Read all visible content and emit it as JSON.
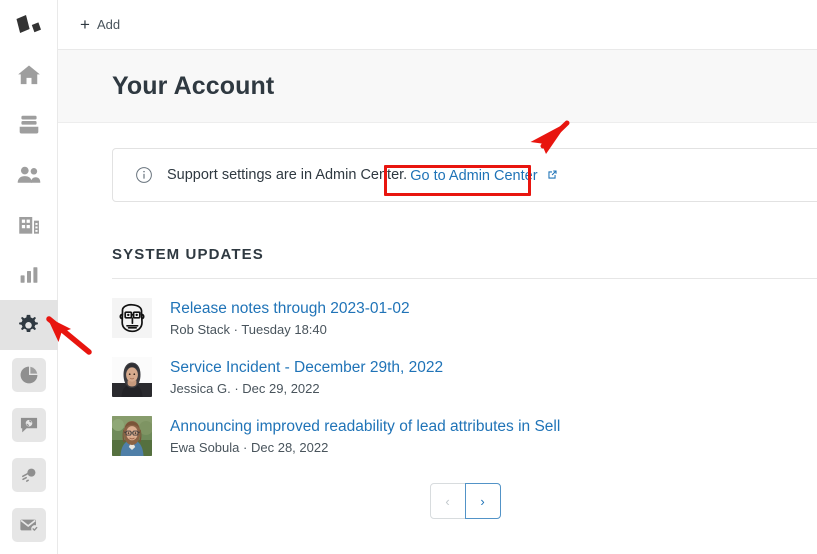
{
  "sidebar": {
    "logo": {
      "name": "zendesk-logo"
    },
    "nav_items": [
      {
        "icon": "home-icon",
        "label": "Home",
        "active": false
      },
      {
        "icon": "views-icon",
        "label": "Views",
        "active": false
      },
      {
        "icon": "customers-icon",
        "label": "Customers",
        "active": false
      },
      {
        "icon": "organizations-icon",
        "label": "Organizations",
        "active": false
      },
      {
        "icon": "reporting-icon",
        "label": "Reporting",
        "active": false
      },
      {
        "icon": "gear-icon",
        "label": "Admin",
        "active": true
      }
    ],
    "app_items": [
      {
        "icon": "explore-icon",
        "label": "Explore"
      },
      {
        "icon": "chat-icon",
        "label": "Chat"
      },
      {
        "icon": "guide-icon",
        "label": "Guide"
      },
      {
        "icon": "mail-check-icon",
        "label": "Email"
      }
    ]
  },
  "topbar": {
    "add_label": "Add",
    "add_icon": "plus-icon"
  },
  "header": {
    "title": "Your Account"
  },
  "notice": {
    "icon": "info-circle-icon",
    "text": "Support settings are in Admin Center.",
    "link_label": "Go to Admin Center",
    "link_icon": "external-link-icon"
  },
  "system_updates": {
    "section_label": "SYSTEM UPDATES",
    "items": [
      {
        "title": "Release notes through 2023-01-02",
        "author": "Rob Stack",
        "separator": "·",
        "date": "Tuesday 18:40",
        "avatar": "avatar-doodle-face"
      },
      {
        "title": "Service Incident - December 29th, 2022",
        "author": "Jessica G.",
        "separator": "·",
        "date": "Dec 29, 2022",
        "avatar": "avatar-dark-hair-woman"
      },
      {
        "title": "Announcing improved readability of lead attributes in Sell",
        "author": "Ewa Sobula",
        "separator": "·",
        "date": "Dec 28, 2022",
        "avatar": "avatar-glasses-woman"
      }
    ],
    "pagination": {
      "previous_label": "‹",
      "next_label": "›"
    }
  },
  "annotations": {
    "highlight_color": "#e8150f",
    "arrow_to_admin_center_link": "arrow-pointing-to-go-to-admin-center",
    "arrow_to_admin_gear": "arrow-pointing-to-admin-gear-icon"
  },
  "colors": {
    "link": "#1f73b7",
    "text": "#2f3941",
    "muted": "#49545c",
    "header_bg": "#f8f8f8",
    "active_nav_bg": "#e3e3e3"
  }
}
